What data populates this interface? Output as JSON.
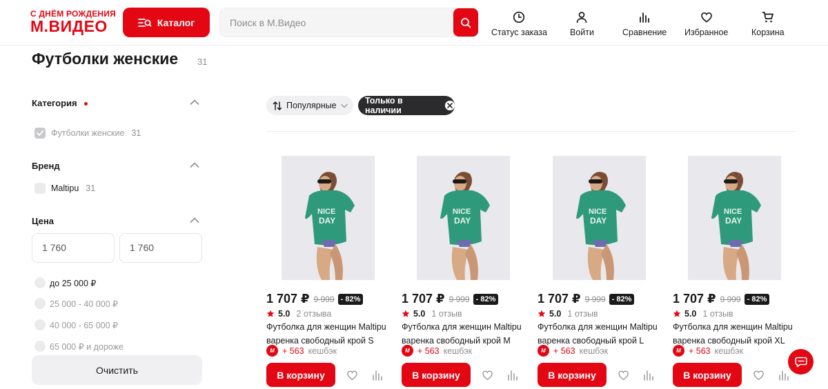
{
  "header": {
    "logo_top": "С ДНЁМ РОЖДЕНИЯ",
    "logo_main": "М.ВИДЕО",
    "catalog_label": "Каталог",
    "search_placeholder": "Поиск в М.Видео",
    "nav": [
      {
        "label": "Статус заказа",
        "icon": "clock-icon"
      },
      {
        "label": "Войти",
        "icon": "user-icon"
      },
      {
        "label": "Сравнение",
        "icon": "bar-chart-icon"
      },
      {
        "label": "Избранное",
        "icon": "heart-icon"
      },
      {
        "label": "Корзина",
        "icon": "cart-icon"
      }
    ]
  },
  "page": {
    "title": "Футболки женские",
    "count": "31"
  },
  "filters": {
    "category": {
      "heading": "Категория",
      "item_label": "Футболки женские",
      "item_count": "31"
    },
    "brand": {
      "heading": "Бренд",
      "item_label": "Maltipu",
      "item_count": "31"
    },
    "price": {
      "heading": "Цена",
      "min_value": "1 760",
      "max_value": "1 760",
      "ranges": [
        "до 25 000 ₽",
        "25 000 - 40 000 ₽",
        "40 000 - 65 000 ₽",
        "65 000 ₽ и дороже"
      ]
    },
    "clear_label": "Очистить"
  },
  "sort": {
    "label": "Популярные",
    "in_stock_label": "Только в наличии"
  },
  "products": [
    {
      "price": "1 707 ₽",
      "old_price": "9 999",
      "discount": "- 82%",
      "rating": "5.0",
      "reviews": "2 отзыва",
      "name": "Футболка для женщин Maltipu варенка свободный крой S",
      "cashback": "+ 563",
      "cashback_label": "кешбэк",
      "buy_label": "В корзину"
    },
    {
      "price": "1 707 ₽",
      "old_price": "9 999",
      "discount": "- 82%",
      "rating": "5.0",
      "reviews": "1 отзыв",
      "name": "Футболка для женщин Maltipu варенка свободный крой M",
      "cashback": "+ 563",
      "cashback_label": "кешбэк",
      "buy_label": "В корзину"
    },
    {
      "price": "1 707 ₽",
      "old_price": "9 999",
      "discount": "- 82%",
      "rating": "5.0",
      "reviews": "1 отзыв",
      "name": "Футболка для женщин Maltipu варенка свободный крой L",
      "cashback": "+ 563",
      "cashback_label": "кешбэк",
      "buy_label": "В корзину"
    },
    {
      "price": "1 707 ₽",
      "old_price": "9 999",
      "discount": "- 82%",
      "rating": "5.0",
      "reviews": "1 отзыв",
      "name": "Футболка для женщин Maltipu варенка свободный крой XL",
      "cashback": "+ 563",
      "cashback_label": "кешбэк",
      "buy_label": "В корзину"
    }
  ],
  "colors": {
    "brand_red": "#e30613",
    "dark_chip": "#2b2b2e",
    "shirt_green": "#2e9a7b"
  }
}
